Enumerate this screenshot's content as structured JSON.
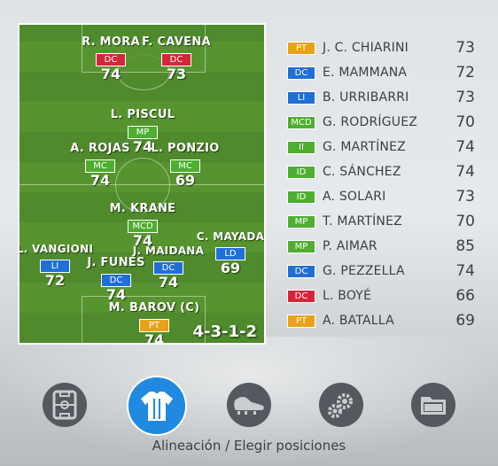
{
  "formation": "4-3-1-2",
  "colors": {
    "PT": "#e8a21a",
    "DC": "#1f6fd6",
    "LI": "#1f6fd6",
    "LD": "#1f6fd6",
    "MCD": "#4eae2f",
    "II": "#4eae2f",
    "ID": "#4eae2f",
    "MC": "#4eae2f",
    "MP": "#4eae2f",
    "DC_att": "#d4253b"
  },
  "pitch_players": [
    {
      "name": "R. MORA",
      "pos": "DC",
      "rating": "74",
      "role": "att"
    },
    {
      "name": "F. CAVENA",
      "pos": "DC",
      "rating": "73",
      "role": "att"
    },
    {
      "name": "L. PISCUL",
      "pos": "MP",
      "rating": "74",
      "role": "mid"
    },
    {
      "name": "A. ROJAS",
      "pos": "MC",
      "rating": "74",
      "role": "mid"
    },
    {
      "name": "L. PONZIO",
      "pos": "MC",
      "rating": "69",
      "role": "mid"
    },
    {
      "name": "M. KRANE",
      "pos": "MCD",
      "rating": "74",
      "role": "mid"
    },
    {
      "name": "L. VANGIONI",
      "pos": "LI",
      "rating": "72",
      "role": "def"
    },
    {
      "name": "J. MAIDANA",
      "pos": "DC",
      "rating": "74",
      "role": "def"
    },
    {
      "name": "C. MAYADA",
      "pos": "LD",
      "rating": "69",
      "role": "def"
    },
    {
      "name": "J. FUNES",
      "pos": "DC",
      "rating": "74",
      "role": "def"
    },
    {
      "name": "M. BAROV (C)",
      "pos": "PT",
      "rating": "74",
      "role": "gk"
    }
  ],
  "roster": [
    {
      "pos": "PT",
      "name": "J. C. CHIARINI",
      "rating": "73",
      "color": "#e8a21a"
    },
    {
      "pos": "DC",
      "name": "E. MAMMANA",
      "rating": "72",
      "color": "#1f6fd6"
    },
    {
      "pos": "LI",
      "name": "B. URRIBARRI",
      "rating": "73",
      "color": "#1f6fd6"
    },
    {
      "pos": "MCD",
      "name": "G. RODRÍGUEZ",
      "rating": "70",
      "color": "#4eae2f"
    },
    {
      "pos": "II",
      "name": "G. MARTÍNEZ",
      "rating": "74",
      "color": "#4eae2f"
    },
    {
      "pos": "ID",
      "name": "C. SÁNCHEZ",
      "rating": "74",
      "color": "#4eae2f"
    },
    {
      "pos": "ID",
      "name": "A. SOLARI",
      "rating": "73",
      "color": "#4eae2f"
    },
    {
      "pos": "MP",
      "name": "T. MARTÍNEZ",
      "rating": "70",
      "color": "#4eae2f"
    },
    {
      "pos": "MP",
      "name": "P. AIMAR",
      "rating": "85",
      "color": "#4eae2f"
    },
    {
      "pos": "DC",
      "name": "G. PEZZELLA",
      "rating": "74",
      "color": "#1f6fd6"
    },
    {
      "pos": "DC",
      "name": "L. BOYÉ",
      "rating": "66",
      "color": "#d4253b"
    },
    {
      "pos": "PT",
      "name": "A. BATALLA",
      "rating": "69",
      "color": "#e8a21a"
    }
  ],
  "nav": [
    {
      "icon": "tactics-board-icon",
      "active": false
    },
    {
      "icon": "jersey-icon",
      "active": true
    },
    {
      "icon": "boot-icon",
      "active": false
    },
    {
      "icon": "gears-icon",
      "active": false
    },
    {
      "icon": "folder-icon",
      "active": false
    }
  ],
  "caption": "Alineación / Elegir posiciones"
}
